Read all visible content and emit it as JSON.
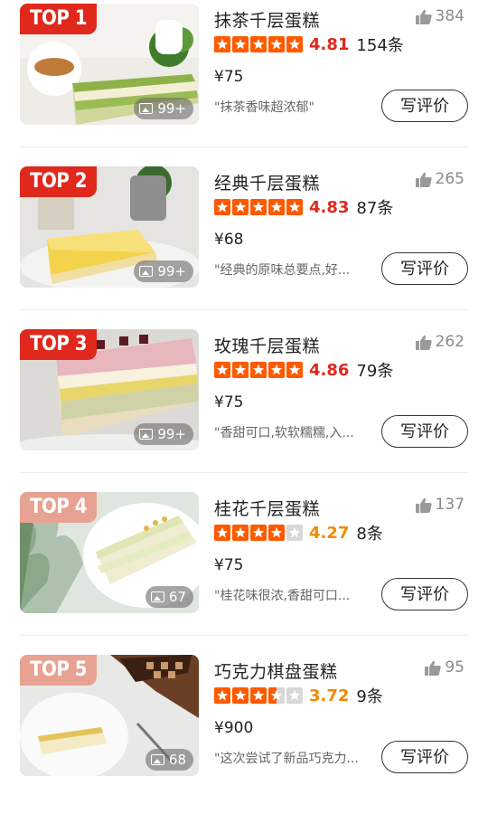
{
  "items": [
    {
      "rank": "TOP 1",
      "name": "抹茶千层蛋糕",
      "likes": "384",
      "rating": 4.81,
      "rating_text": "4.81",
      "review_count": "154条",
      "price": "¥75",
      "photo_count": "99+",
      "snippet": "\"抹茶香味超浓郁\"",
      "button": "写评价",
      "stars": [
        "full",
        "full",
        "full",
        "full",
        "full"
      ],
      "badge_color": "#e0281c"
    },
    {
      "rank": "TOP 2",
      "name": "经典千层蛋糕",
      "likes": "265",
      "rating": 4.83,
      "rating_text": "4.83",
      "review_count": "87条",
      "price": "¥68",
      "photo_count": "99+",
      "snippet": "\"经典的原味总要点,好...",
      "button": "写评价",
      "stars": [
        "full",
        "full",
        "full",
        "full",
        "full"
      ],
      "badge_color": "#e0281c"
    },
    {
      "rank": "TOP 3",
      "name": "玫瑰千层蛋糕",
      "likes": "262",
      "rating": 4.86,
      "rating_text": "4.86",
      "review_count": "79条",
      "price": "¥75",
      "photo_count": "99+",
      "snippet": "\"香甜可口,软软糯糯,入...",
      "button": "写评价",
      "stars": [
        "full",
        "full",
        "full",
        "full",
        "full"
      ],
      "badge_color": "#e0281c"
    },
    {
      "rank": "TOP 4",
      "name": "桂花千层蛋糕",
      "likes": "137",
      "rating": 4.27,
      "rating_text": "4.27",
      "review_count": "8条",
      "price": "¥75",
      "photo_count": "67",
      "snippet": "\"桂花味很浓,香甜可口...",
      "button": "写评价",
      "stars": [
        "full",
        "full",
        "full",
        "full",
        "empty"
      ],
      "badge_color": "#e8a291"
    },
    {
      "rank": "TOP 5",
      "name": "巧克力棋盘蛋糕",
      "likes": "95",
      "rating": 3.72,
      "rating_text": "3.72",
      "review_count": "9条",
      "price": "¥900",
      "photo_count": "68",
      "snippet": "\"这次尝试了新品巧克力...",
      "button": "写评价",
      "stars": [
        "full",
        "full",
        "full",
        "half",
        "empty"
      ],
      "badge_color": "#e8a291"
    }
  ],
  "colors": {
    "accent_red": "#e0281c",
    "accent_orange": "#f08a00",
    "star_fill": "#ff5a00",
    "star_empty": "#d8d8d8"
  },
  "icons": {
    "like": "thumbs-up-icon",
    "photo": "image-icon",
    "star": "star-icon"
  }
}
